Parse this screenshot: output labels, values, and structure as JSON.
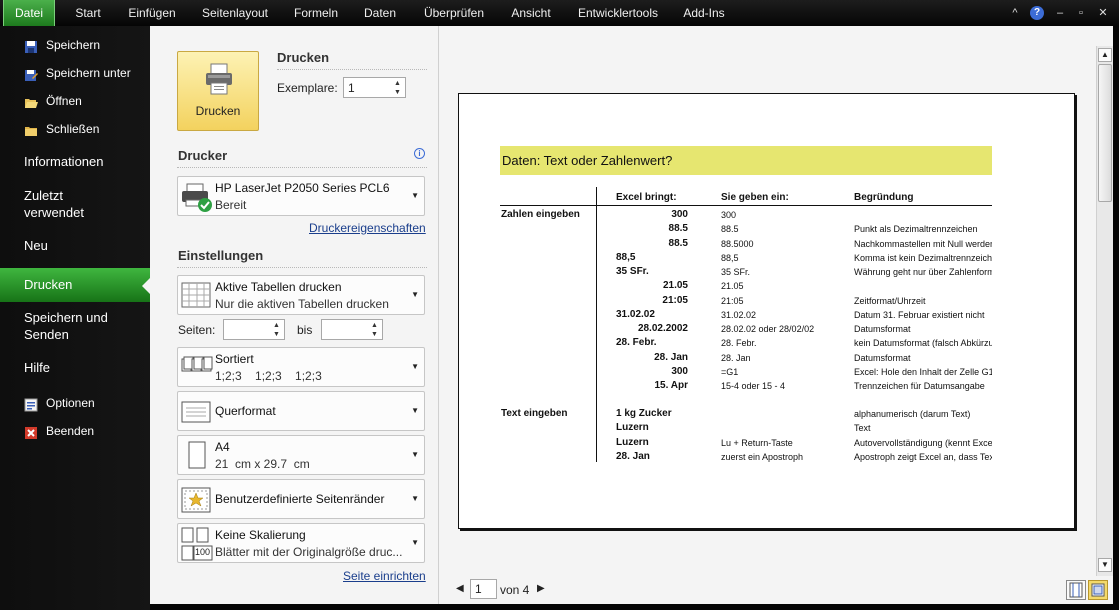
{
  "ribbon": {
    "tabs": [
      "Datei",
      "Start",
      "Einfügen",
      "Seitenlayout",
      "Formeln",
      "Daten",
      "Überprüfen",
      "Ansicht",
      "Entwicklertools",
      "Add-Ins"
    ],
    "help_symbol": "?",
    "window_minimize": "–",
    "window_restore": "▫",
    "window_close": "✕",
    "collapse_symbol": "^"
  },
  "nav": {
    "items": [
      {
        "label": "Speichern",
        "icon": "save-icon"
      },
      {
        "label": "Speichern unter",
        "icon": "save-as-icon"
      },
      {
        "label": "Öffnen",
        "icon": "open-folder-icon"
      },
      {
        "label": "Schließen",
        "icon": "close-folder-icon"
      },
      {
        "label": "Informationen"
      },
      {
        "label": "Zuletzt verwendet"
      },
      {
        "label": "Neu"
      },
      {
        "label": "Drucken",
        "active": true
      },
      {
        "label": "Speichern und Senden"
      },
      {
        "label": "Hilfe"
      },
      {
        "label": "Optionen",
        "icon": "options-icon"
      },
      {
        "label": "Beenden",
        "icon": "exit-icon"
      }
    ]
  },
  "print": {
    "button_label": "Drucken",
    "section_title": "Drucken",
    "copies_label": "Exemplare:",
    "copies_value": "1"
  },
  "printer": {
    "section_title": "Drucker",
    "info_symbol": "i",
    "name": "HP LaserJet P2050 Series PCL6",
    "status": "Bereit",
    "properties_link": "Druckereigenschaften"
  },
  "settings": {
    "section_title": "Einstellungen",
    "scope_title": "Aktive Tabellen drucken",
    "scope_sub": "Nur die aktiven Tabellen drucken",
    "pages_label": "Seiten:",
    "pages_to_label": "bis",
    "collate_title": "Sortiert",
    "collate_sub": "1;2;3    1;2;3    1;2;3",
    "orientation_title": "Querformat",
    "paper_title": "A4",
    "paper_sub": "21  cm x 29.7  cm",
    "margins_title": "Benutzerdefinierte Seitenränder",
    "scaling_title": "Keine Skalierung",
    "scaling_sub": "Blätter mit der Originalgröße druc...",
    "scaling_icon_text": "100",
    "page_setup_link": "Seite einrichten"
  },
  "preview": {
    "heading": "Daten: Text oder Zahlenwert?",
    "col_headers": {
      "excel": "Excel bringt:",
      "input": "Sie geben ein:",
      "reason": "Begründung"
    },
    "group1_label": "Zahlen eingeben",
    "group2_label": "Text eingeben",
    "rows1": [
      {
        "excel": "300",
        "align": "right",
        "input": "300",
        "reason": ""
      },
      {
        "excel": "88.5",
        "align": "right",
        "input": "88.5",
        "reason": "Punkt als Dezimaltrennzeichen"
      },
      {
        "excel": "88.5",
        "align": "right",
        "input": "88.5000",
        "reason": "Nachkommastellen mit Null werden"
      },
      {
        "excel": "88,5",
        "align": "left",
        "input": "88,5",
        "reason": "Komma ist kein Dezimaltrennzeiche"
      },
      {
        "excel": "35 SFr.",
        "align": "left",
        "input": "35 SFr.",
        "reason": "Währung geht nur über Zahlenform"
      },
      {
        "excel": "21.05",
        "align": "right",
        "input": "21.05",
        "reason": ""
      },
      {
        "excel": "21:05",
        "align": "right",
        "input": "21:05",
        "reason": "Zeitformat/Uhrzeit"
      },
      {
        "excel": "31.02.02",
        "align": "left",
        "input": "31.02.02",
        "reason": "Datum 31. Februar existiert nicht"
      },
      {
        "excel": "28.02.2002",
        "align": "right",
        "input": "28.02.02 oder 28/02/02",
        "reason": "Datumsformat"
      },
      {
        "excel": "28. Febr.",
        "align": "left",
        "input": "28. Febr.",
        "reason": "kein Datumsformat (falsch Abkürzu"
      },
      {
        "excel": "28. Jan",
        "align": "right",
        "input": "28. Jan",
        "reason": "Datumsformat"
      },
      {
        "excel": "300",
        "align": "right",
        "input": "=G1",
        "reason": "Excel: Hole den Inhalt der Zelle G1"
      },
      {
        "excel": "15. Apr",
        "align": "right",
        "input": "15-4 oder 15 - 4",
        "reason": "Trennzeichen für Datumsangabe"
      }
    ],
    "rows2": [
      {
        "excel": "1 kg Zucker",
        "input": "",
        "reason": "alphanumerisch (darum Text)"
      },
      {
        "excel": "Luzern",
        "input": "",
        "reason": "Text"
      },
      {
        "excel": "Luzern",
        "input": "Lu + Return-Taste",
        "reason": "Autovervollständigung (kennt Excel"
      },
      {
        "excel": "28. Jan",
        "input": "zuerst ein Apostroph",
        "reason": "Apostroph zeigt Excel an, dass Text"
      }
    ],
    "page_number": "1",
    "page_of": "von 4"
  }
}
